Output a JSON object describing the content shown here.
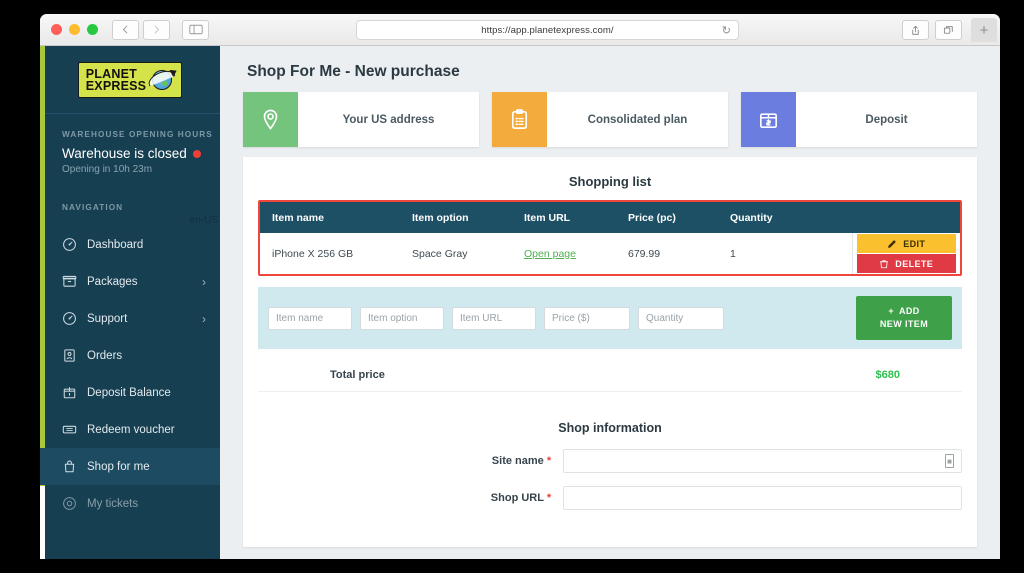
{
  "browser": {
    "url": "https://app.planetexpress.com/",
    "reload_icon": "reload-icon",
    "back_icon": "back-arrow-icon",
    "forward_icon": "forward-arrow-icon",
    "sidebar_toggle_icon": "sidebar-toggle-icon",
    "share_icon": "share-icon",
    "tabs_icon": "show-all-tabs-icon",
    "new_tab_label": "+"
  },
  "sidebar": {
    "logo": {
      "line1": "PLANET",
      "line2": "EXPRESS",
      "icon": "globe-with-arrow-icon"
    },
    "warehouse": {
      "section_label": "WAREHOUSE OPENING HOURS",
      "status": "Warehouse is closed",
      "status_color": "#ef3e36",
      "subtext": "Opening in 10h 23m"
    },
    "nav_label": "NAVIGATION",
    "locale": "en-US",
    "items": [
      {
        "label": "Dashboard",
        "icon": "dashboard-gauge-icon",
        "chevron": false,
        "active": false
      },
      {
        "label": "Packages",
        "icon": "box-icon",
        "chevron": true,
        "active": false
      },
      {
        "label": "Support",
        "icon": "support-gauge-icon",
        "chevron": true,
        "active": false
      },
      {
        "label": "Orders",
        "icon": "order-card-icon",
        "chevron": false,
        "active": false
      },
      {
        "label": "Deposit Balance",
        "icon": "deposit-box-icon",
        "chevron": false,
        "active": false
      },
      {
        "label": "Redeem voucher",
        "icon": "ticket-icon",
        "chevron": false,
        "active": false
      },
      {
        "label": "Shop for me",
        "icon": "shopping-bag-icon",
        "chevron": false,
        "active": true
      },
      {
        "label": "My tickets",
        "icon": "circle-icon",
        "chevron": false,
        "active": false
      }
    ]
  },
  "main": {
    "page_title": "Shop For Me - New purchase",
    "cards": [
      {
        "label": "Your US address",
        "icon": "map-pin-icon",
        "color": "#74c47d"
      },
      {
        "label": "Consolidated plan",
        "icon": "clipboard-icon",
        "color": "#f4ab3e"
      },
      {
        "label": "Deposit",
        "icon": "money-box-icon",
        "color": "#6b7ee0"
      }
    ],
    "shopping_list": {
      "title": "Shopping list",
      "highlight_color": "#f0453a",
      "columns": [
        "Item name",
        "Item option",
        "Item URL",
        "Price (pc)",
        "Quantity",
        ""
      ],
      "rows": [
        {
          "item_name": "iPhone X 256 GB",
          "item_option": "Space Gray",
          "item_url_label": "Open page",
          "price": "679.99",
          "quantity": "1",
          "edit_label": "EDIT",
          "delete_label": "DELETE"
        }
      ]
    },
    "add_item": {
      "placeholders": {
        "item_name": "Item name",
        "item_option": "Item option",
        "item_url": "Item URL",
        "price": "Price ($)",
        "quantity": "Quantity"
      },
      "values": {
        "item_name": "",
        "item_option": "",
        "item_url": "",
        "price": "",
        "quantity": ""
      },
      "button_line1": "ADD",
      "button_line2": "NEW ITEM",
      "button_plus": "+"
    },
    "total": {
      "label": "Total price",
      "value": "$680",
      "value_color": "#2fbf4e"
    },
    "shop_information": {
      "title": "Shop information",
      "fields": [
        {
          "label": "Site name",
          "required": "*",
          "value": "",
          "has_inner_icon": true
        },
        {
          "label": "Shop URL",
          "required": "*",
          "value": "",
          "has_inner_icon": false
        }
      ]
    }
  }
}
